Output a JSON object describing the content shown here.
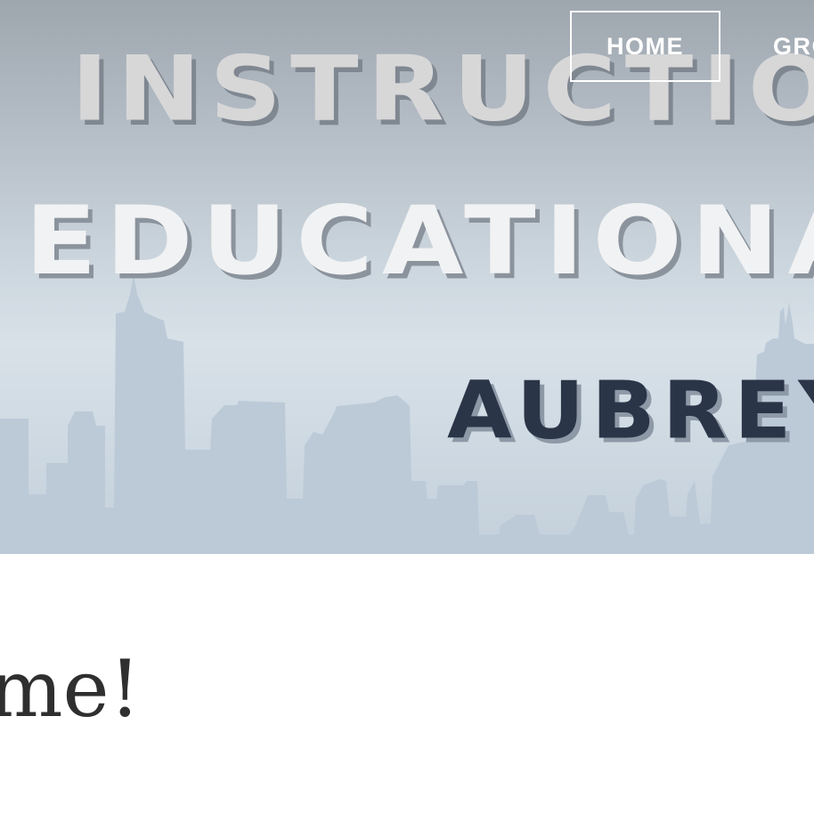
{
  "banner": {
    "title_line1": "Instructiona",
    "title_line2": "Educational T",
    "author": "Aubrey A",
    "text_color_light": "#f1f2f3",
    "text_color_dark": "#2b3548",
    "skyline_color": "#bccad8"
  },
  "nav": {
    "items": [
      {
        "label": "HOME",
        "active": true
      },
      {
        "label": "GROUPS",
        "active": false
      }
    ]
  },
  "main": {
    "heading": "Welcome!"
  }
}
